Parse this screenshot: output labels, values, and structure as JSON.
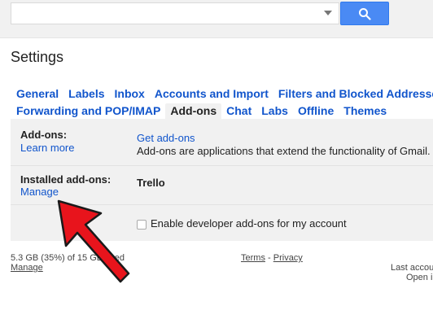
{
  "search": {
    "value": "",
    "placeholder": ""
  },
  "page": {
    "title": "Settings"
  },
  "tabs_row1": [
    {
      "label": "General"
    },
    {
      "label": "Labels"
    },
    {
      "label": "Inbox"
    },
    {
      "label": "Accounts and Import"
    },
    {
      "label": "Filters and Blocked Addresses"
    }
  ],
  "tabs_row2": [
    {
      "label": "Forwarding and POP/IMAP"
    },
    {
      "label": "Add-ons"
    },
    {
      "label": "Chat"
    },
    {
      "label": "Labs"
    },
    {
      "label": "Offline"
    },
    {
      "label": "Themes"
    }
  ],
  "addons": {
    "label": "Add-ons:",
    "learn_more": "Learn more",
    "get_addons": "Get add-ons",
    "description": "Add-ons are applications that extend the functionality of Gmail."
  },
  "installed": {
    "label": "Installed add-ons:",
    "manage": "Manage",
    "item": "Trello"
  },
  "developer": {
    "checkbox_label": "Enable developer add-ons for my account",
    "checked": false
  },
  "footer": {
    "storage": "5.3 GB (35%) of 15 GB used",
    "manage": "Manage",
    "terms": "Terms",
    "separator": "-",
    "privacy": "Privacy",
    "last_activity": "Last accou",
    "open_in": "Open i"
  },
  "colors": {
    "link": "#1155cc",
    "accent": "#4a8af4",
    "annotation_arrow": "#e8141c"
  },
  "icons": {
    "search_button": "search-icon",
    "dropdown": "chevron-down-icon"
  }
}
